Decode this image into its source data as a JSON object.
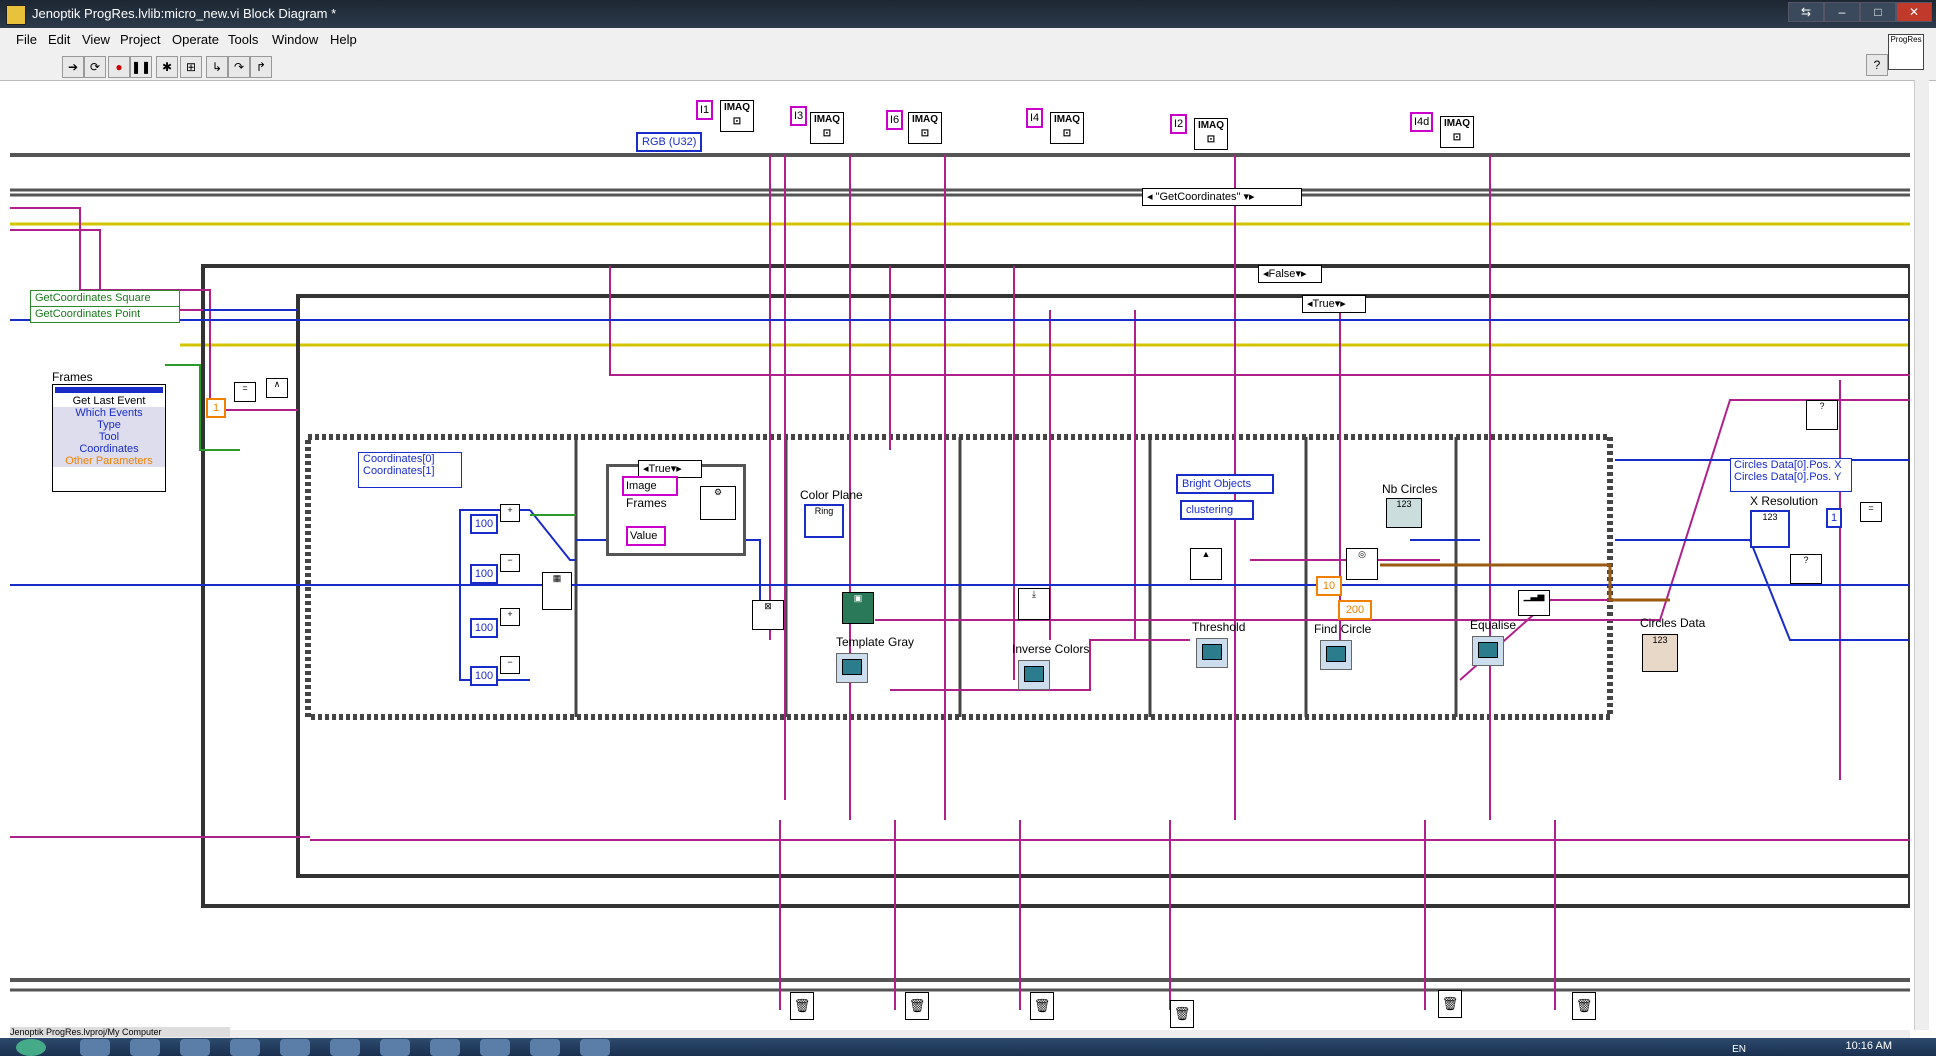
{
  "window": {
    "title": "Jenoptik ProgRes.lvlib:micro_new.vi Block Diagram *",
    "badge": "ProgRes"
  },
  "menu": [
    "File",
    "Edit",
    "View",
    "Project",
    "Operate",
    "Tools",
    "Window",
    "Help"
  ],
  "imaq": {
    "label": "IMAQ",
    "refs": [
      "I1",
      "I3",
      "I6",
      "I4",
      "I2",
      "I4d"
    ],
    "rgb_type": "RGB (U32)"
  },
  "case_selectors": {
    "get_coordinates": "\"GetCoordinates\"",
    "false_case": "False",
    "true_case": "True",
    "inner_true": "True"
  },
  "event_structure": {
    "events": [
      "GetCoordinates Square",
      "GetCoordinates Point"
    ],
    "frames_label": "Frames",
    "items": [
      "Get Last Event",
      "Which Events",
      "Type",
      "Tool",
      "Coordinates",
      "Other Parameters"
    ],
    "one_const": "1"
  },
  "coordinates": {
    "items": [
      "Coordinates[0]",
      "Coordinates[1]"
    ],
    "consts": [
      "100",
      "100",
      "100",
      "100"
    ]
  },
  "inner_case": {
    "image_label": "Image",
    "frames_label": "Frames",
    "value_label": "Value"
  },
  "labels": {
    "color_plane": "Color Plane",
    "template_gray": "Template Gray",
    "inverse_colors": "Inverse Colors",
    "threshold": "Threshold",
    "find_circle": "Find Circle",
    "nb_circles": "Nb Circles",
    "equalise": "Equalise",
    "circles_data": "Circles Data",
    "x_resolution": "X Resolution"
  },
  "threshold": {
    "mode": "Bright Objects",
    "method": "clustering"
  },
  "find_circle": {
    "min": "10",
    "max": "200"
  },
  "nb_circles_value": "123",
  "circles_data_out": [
    "Circles Data[0].Pos. X",
    "Circles Data[0].Pos. Y"
  ],
  "x_res_const": "1",
  "status": {
    "path": "Jenoptik ProgRes.lvproj/My Computer"
  },
  "tray": {
    "language": "EN",
    "clock": "10:16 AM"
  }
}
